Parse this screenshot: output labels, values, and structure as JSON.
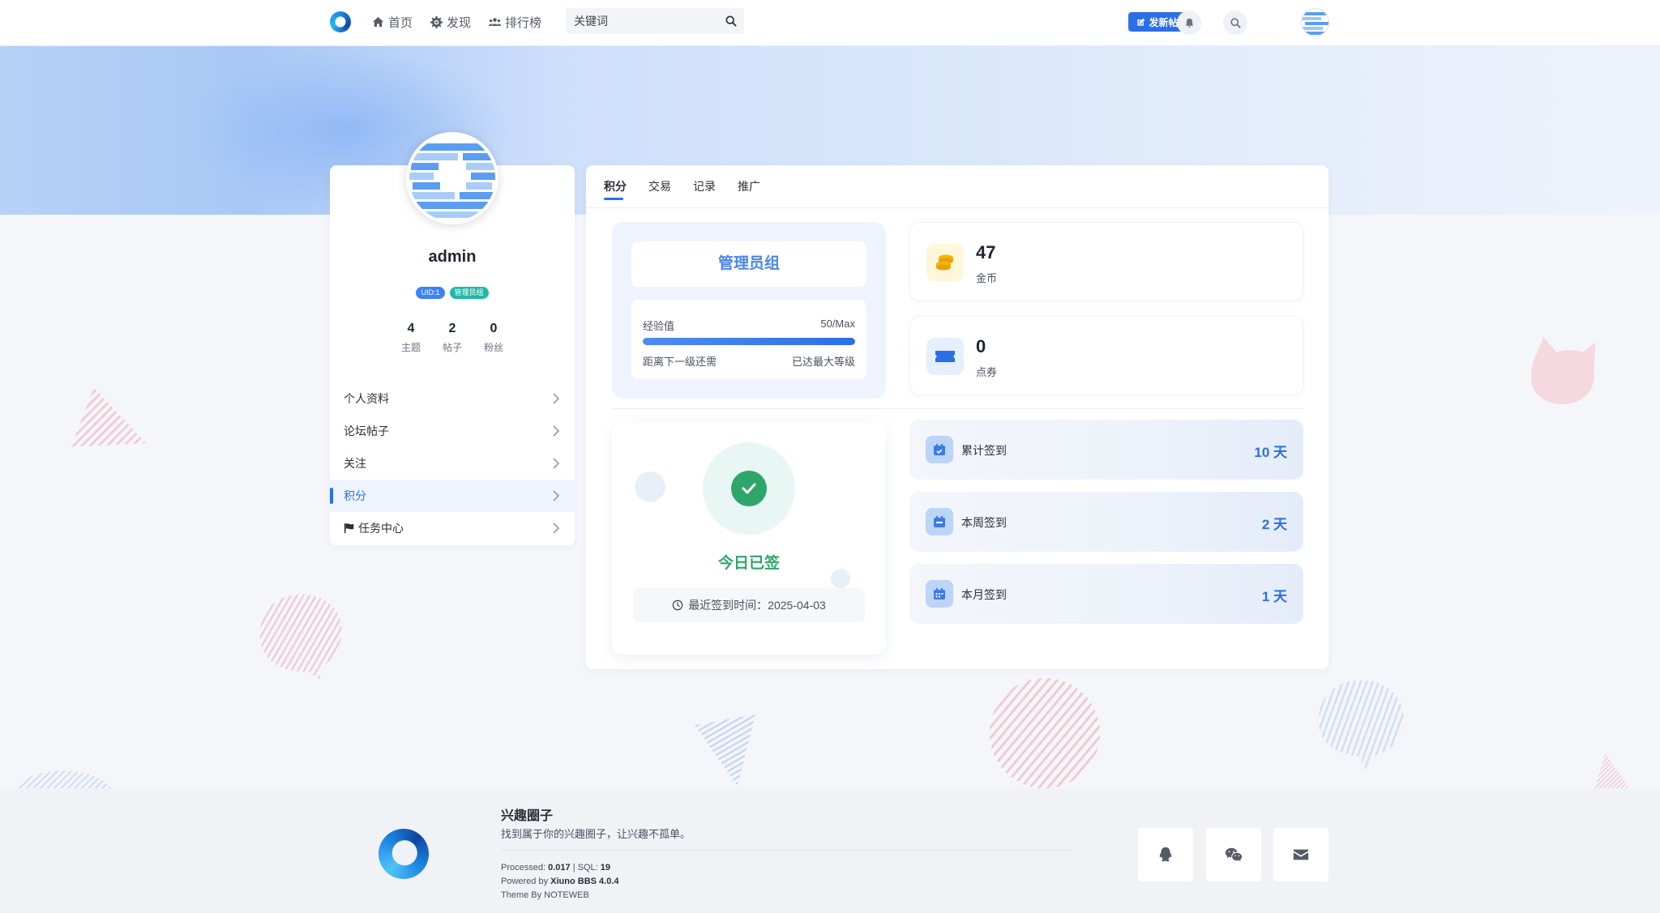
{
  "nav": {
    "home": "首页",
    "discover": "发现",
    "ranking": "排行榜",
    "search_placeholder": "关键词",
    "post_button": "发新帖"
  },
  "profile": {
    "username": "admin",
    "uid_badge": "UID:1",
    "group_badge": "管理员组",
    "stats": [
      {
        "num": "4",
        "label": "主题"
      },
      {
        "num": "2",
        "label": "帖子"
      },
      {
        "num": "0",
        "label": "粉丝"
      }
    ],
    "menu": [
      {
        "label": "个人资料"
      },
      {
        "label": "论坛帖子"
      },
      {
        "label": "关注"
      },
      {
        "label": "积分"
      },
      {
        "label": "任务中心"
      }
    ]
  },
  "tabs": [
    "积分",
    "交易",
    "记录",
    "推广"
  ],
  "level": {
    "group": "管理员组",
    "exp_label": "经验值",
    "exp_value": "50/Max",
    "progress": 1.0,
    "next_label": "距离下一级还需",
    "next_value": "已达最大等级"
  },
  "currency": {
    "gold": {
      "value": "47",
      "label": "金币"
    },
    "ticket": {
      "value": "0",
      "label": "点券"
    }
  },
  "checkin": {
    "status": "今日已签",
    "last_time": "最近签到时间：2025-04-03"
  },
  "sign_stats": [
    {
      "label": "累计签到",
      "value": "10 天"
    },
    {
      "label": "本周签到",
      "value": "2 天"
    },
    {
      "label": "本月签到",
      "value": "1 天"
    }
  ],
  "footer": {
    "site_name": "兴趣圈子",
    "slogan": "找到属于你的兴趣圈子，让兴趣不孤单。",
    "processed_label": "Processed:",
    "processed_value": "0.017",
    "sql_label": "SQL:",
    "sql_value": "19",
    "powered_label": "Powered by",
    "powered_value": "Xiuno BBS 4.0.4",
    "theme": "Theme By NOTEWEB"
  },
  "colors": {
    "accent": "#2b6fe6",
    "success": "#2ea66a",
    "gold": "#f5b400"
  }
}
